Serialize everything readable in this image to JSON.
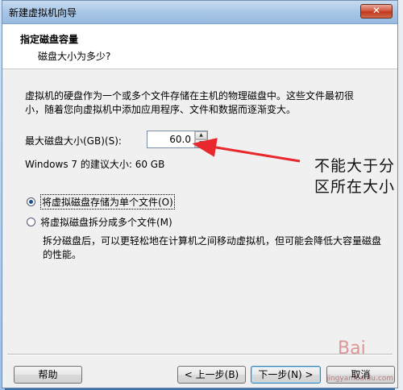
{
  "window": {
    "title": "新建虚拟机向导",
    "close_label": "✕"
  },
  "header": {
    "title": "指定磁盘容量",
    "subtitle": "磁盘大小为多少?"
  },
  "main": {
    "description": "虚拟机的硬盘作为一个或多个文件存储在主机的物理磁盘中。这些文件最初很小，随着您向虚拟机中添加应用程序、文件和数据而逐渐变大。",
    "max_size_label": "最大磁盘大小(GB)(S):",
    "max_size_value": "60.0",
    "recommend_text": "Windows 7 的建议大小: 60 GB",
    "options": [
      {
        "label": "将虚拟磁盘存储为单个文件(O)",
        "selected": true
      },
      {
        "label": "将虚拟磁盘拆分成多个文件(M)",
        "selected": false
      }
    ],
    "split_description": "拆分磁盘后，可以更轻松地在计算机之间移动虚拟机，但可能会降低大容量磁盘的性能。"
  },
  "annotation": {
    "text": "不能大于分区所在大小",
    "arrow_color": "#e8282d"
  },
  "buttons": {
    "help": "帮助",
    "back": "< 上一步(B)",
    "next": "下一步(N) >",
    "cancel": "取消"
  },
  "watermark": {
    "logo": "Bai",
    "url": "jingyan.baidu.com"
  },
  "colors": {
    "titlebar": "#a9c6e6",
    "close_button": "#c0381e",
    "dialog_bg": "#f0f0f0",
    "annotation_arrow": "#e8282d"
  }
}
